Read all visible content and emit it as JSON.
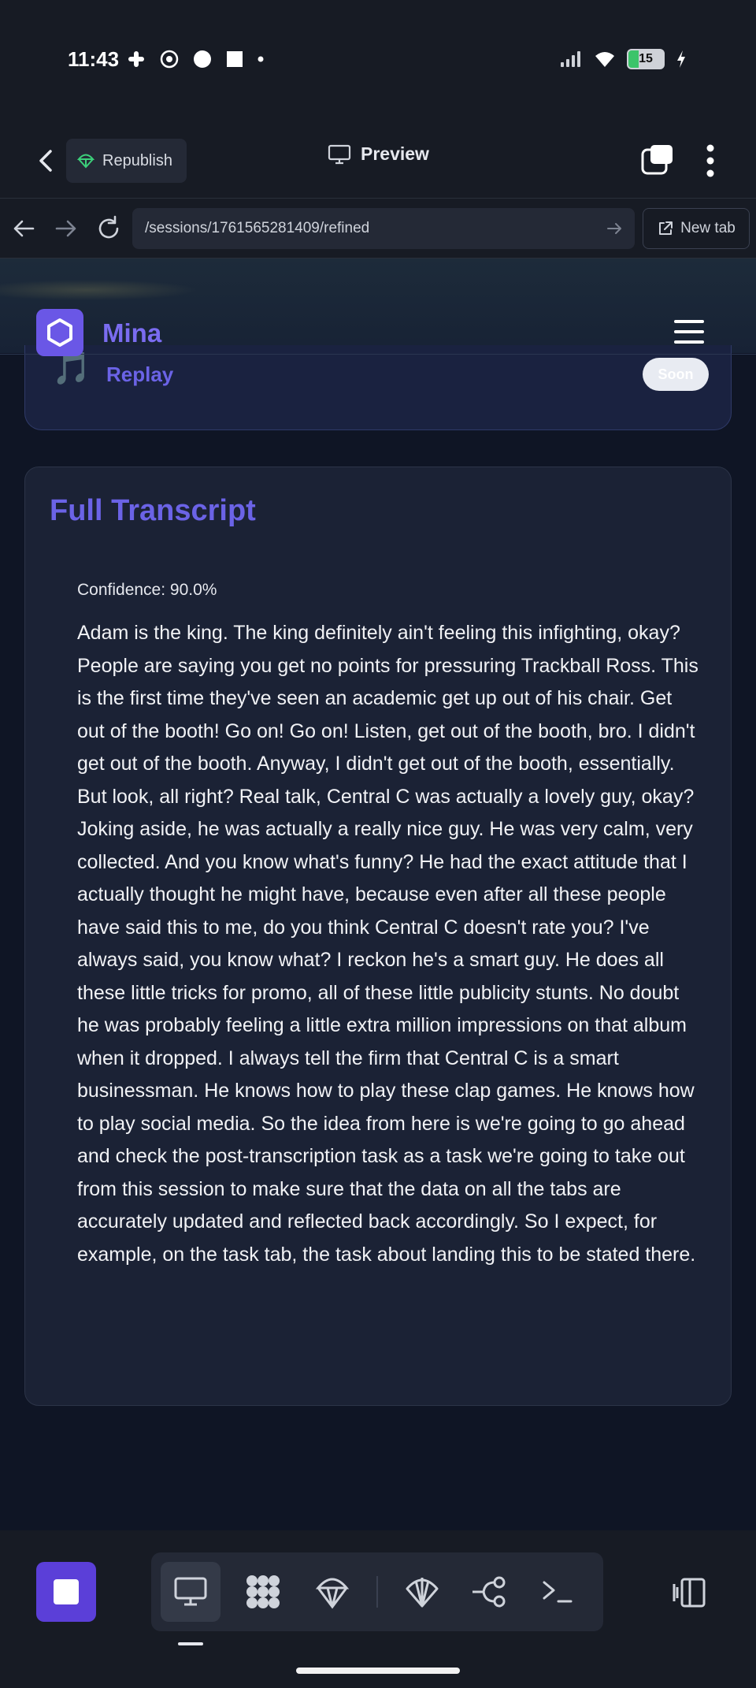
{
  "status_bar": {
    "time": "11:43",
    "battery": "15"
  },
  "app_header": {
    "republish_label": "Republish",
    "preview_label": "Preview"
  },
  "browser": {
    "url": "/sessions/1761565281409/refined",
    "new_tab_label": "New tab"
  },
  "site": {
    "brand": "Mina"
  },
  "replay": {
    "icon": "🎵",
    "label": "Replay",
    "badge": "Soon"
  },
  "transcript": {
    "title": "Full Transcript",
    "confidence": "Confidence: 90.0%",
    "text": "Adam is the king. The king definitely ain't feeling this infighting, okay? People are saying you get no points for pressuring Trackball Ross. This is the first time they've seen an academic get up out of his chair. Get out of the booth! Go on! Go on! Listen, get out of the booth, bro. I didn't get out of the booth. Anyway, I didn't get out of the booth, essentially. But look, all right? Real talk, Central C was actually a lovely guy, okay? Joking aside, he was actually a really nice guy. He was very calm, very collected. And you know what's funny? He had the exact attitude that I actually thought he might have, because even after all these people have said this to me, do you think Central C doesn't rate you? I've always said, you know what? I reckon he's a smart guy. He does all these little tricks for promo, all of these little publicity stunts. No doubt he was probably feeling a little extra million impressions on that album when it dropped. I always tell the firm that Central C is a smart businessman. He knows how to play these clap games. He knows how to play social media. So the idea from here is we're going to go ahead and check the post-transcription task as a task we're going to take out from this session to make sure that the data on all the tabs are accurately updated and reflected back accordingly. So I expect, for example, on the task tab, the task about landing this to be stated there."
  },
  "toolbar": {
    "tools": [
      "desktop-icon",
      "apps-grid-icon",
      "parachute-icon",
      "shell-icon",
      "workflow-icon",
      "terminal-icon"
    ]
  },
  "colors": {
    "accent": "#6b63e6",
    "stop": "#5b3fd8",
    "background": "#0f1525"
  }
}
